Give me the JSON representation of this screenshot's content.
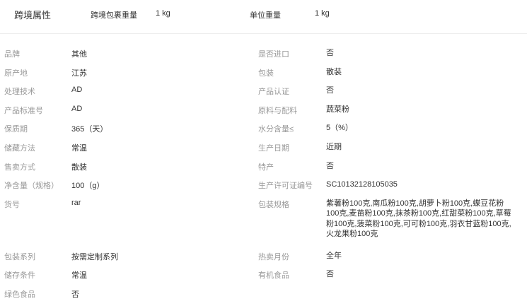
{
  "cross_border": {
    "title": "跨境属性",
    "package_weight_label": "跨境包裹重量",
    "package_weight_value": "1 kg",
    "unit_weight_label": "单位重量",
    "unit_weight_value": "1 kg"
  },
  "attributes": [
    {
      "left_label": "品牌",
      "left_value": "其他",
      "right_label": "是否进口",
      "right_value": "否"
    },
    {
      "left_label": "原产地",
      "left_value": "江苏",
      "right_label": "包装",
      "right_value": "散装"
    },
    {
      "left_label": "处理技术",
      "left_value": "AD",
      "right_label": "产品认证",
      "right_value": "否"
    },
    {
      "left_label": "产品标准号",
      "left_value": "AD",
      "right_label": "原料与配料",
      "right_value": "蔬菜粉"
    },
    {
      "left_label": "保质期",
      "left_value": "365（天）",
      "right_label": "水分含量≤",
      "right_value": "5（%）"
    },
    {
      "left_label": "储藏方法",
      "left_value": "常温",
      "right_label": "生产日期",
      "right_value": "近期"
    },
    {
      "left_label": "售卖方式",
      "left_value": "散装",
      "right_label": "特产",
      "right_value": "否"
    },
    {
      "left_label": "净含量（规格）",
      "left_value": "100（g）",
      "right_label": "生产许可证编号",
      "right_value": "SC10132128105035"
    },
    {
      "left_label": "货号",
      "left_value": "rar",
      "right_label": "包装规格",
      "right_value": "紫薯粉100克,南瓜粉100克,胡萝卜粉100克,蝶豆花粉100克,麦苗粉100克,抹茶粉100克,红甜菜粉100克,草莓粉100克,菠菜粉100克,可可粉100克,羽衣甘蓝粉100克,火龙果粉100克"
    },
    {
      "left_label": "包装系列",
      "left_value": "按需定制系列",
      "right_label": "热卖月份",
      "right_value": "全年"
    },
    {
      "left_label": "储存条件",
      "left_value": "常温",
      "right_label": "有机食品",
      "right_value": "否"
    },
    {
      "left_label": "绿色食品",
      "left_value": "否",
      "right_label": "",
      "right_value": ""
    }
  ]
}
